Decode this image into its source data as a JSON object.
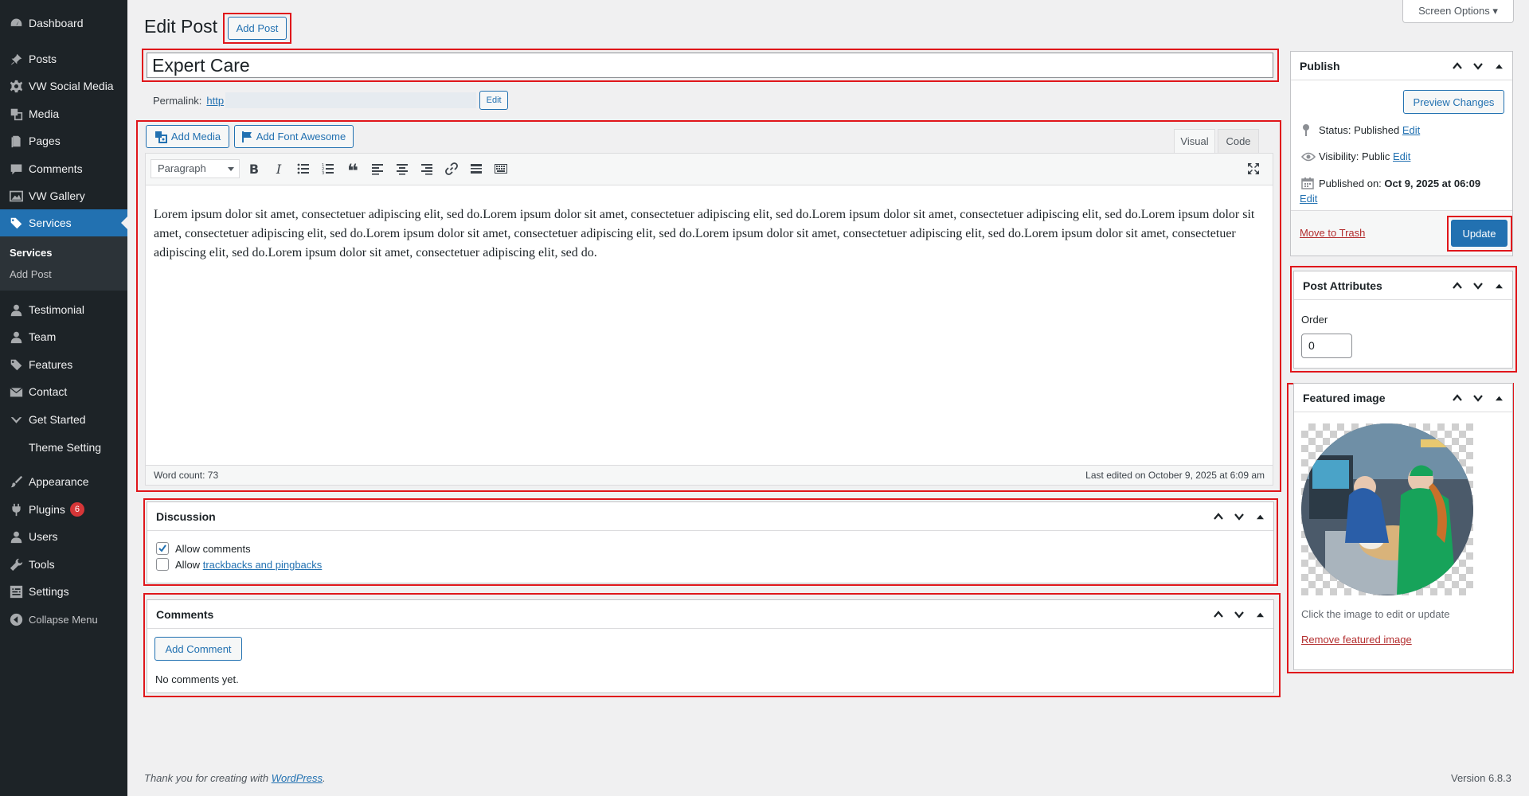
{
  "sidebar": {
    "items": [
      {
        "label": "Dashboard",
        "icon": "dashboard-icon"
      },
      {
        "label": "Posts",
        "icon": "pin-icon"
      },
      {
        "label": "VW Social Media",
        "icon": "gear-icon"
      },
      {
        "label": "Media",
        "icon": "media-icon"
      },
      {
        "label": "Pages",
        "icon": "page-icon"
      },
      {
        "label": "Comments",
        "icon": "comment-icon"
      },
      {
        "label": "VW Gallery",
        "icon": "gallery-icon"
      },
      {
        "label": "Services",
        "icon": "tag-icon"
      },
      {
        "label": "Testimonial",
        "icon": "person-icon"
      },
      {
        "label": "Team",
        "icon": "person-icon"
      },
      {
        "label": "Features",
        "icon": "tag-icon"
      },
      {
        "label": "Contact",
        "icon": "mail-icon"
      },
      {
        "label": "Get Started",
        "icon": "chevron-down-icon"
      },
      {
        "label": "Theme Setting",
        "icon": ""
      },
      {
        "label": "Appearance",
        "icon": "brush-icon"
      },
      {
        "label": "Plugins",
        "icon": "plugin-icon",
        "badge": "6"
      },
      {
        "label": "Users",
        "icon": "users-icon"
      },
      {
        "label": "Tools",
        "icon": "wrench-icon"
      },
      {
        "label": "Settings",
        "icon": "settings-icon"
      },
      {
        "label": "Collapse Menu",
        "icon": "collapse-icon"
      }
    ],
    "submenu": {
      "current": "Services",
      "add": "Add Post"
    },
    "accent": "#2271b1"
  },
  "header": {
    "title": "Edit Post",
    "add_button": "Add Post",
    "screen_options": "Screen Options ▾"
  },
  "post": {
    "title": "Expert Care",
    "permalink_label": "Permalink:",
    "permalink_url": "http",
    "permalink_edit": "Edit"
  },
  "editor": {
    "add_media": "Add Media",
    "add_font_awesome": "Add Font Awesome",
    "tab_visual": "Visual",
    "tab_code": "Code",
    "format_select": "Paragraph",
    "content": "Lorem ipsum dolor sit amet, consectetuer adipiscing elit, sed do.Lorem ipsum dolor sit amet, consectetuer adipiscing elit, sed do.Lorem ipsum dolor sit amet, consectetuer adipiscing elit, sed do.Lorem ipsum dolor sit amet, consectetuer adipiscing elit, sed do.Lorem ipsum dolor sit amet, consectetuer adipiscing elit, sed do.Lorem ipsum dolor sit amet, consectetuer adipiscing elit, sed do.Lorem ipsum dolor sit amet, consectetuer adipiscing elit, sed do.Lorem ipsum dolor sit amet, consectetuer adipiscing elit, sed do.",
    "word_count": "Word count: 73",
    "last_edited": "Last edited on October 9, 2025 at 6:09 am"
  },
  "discussion": {
    "title": "Discussion",
    "allow_comments": "Allow comments",
    "allow_prefix": "Allow",
    "trackbacks_link": "trackbacks and pingbacks"
  },
  "comments": {
    "title": "Comments",
    "add_button": "Add Comment",
    "empty": "No comments yet."
  },
  "publish": {
    "title": "Publish",
    "preview": "Preview Changes",
    "status_label": "Status:",
    "status_value": "Published",
    "status_edit": "Edit",
    "visibility_label": "Visibility:",
    "visibility_value": "Public",
    "visibility_edit": "Edit",
    "published_label": "Published on:",
    "published_value": "Oct 9, 2025 at 06:09",
    "published_edit": "Edit",
    "trash": "Move to Trash",
    "update": "Update"
  },
  "attributes": {
    "title": "Post Attributes",
    "order_label": "Order",
    "order_value": "0"
  },
  "featured": {
    "title": "Featured image",
    "hint": "Click the image to edit or update",
    "remove": "Remove featured image"
  },
  "footer": {
    "thanks_prefix": "Thank you for creating with ",
    "wp_link": "WordPress",
    "thanks_suffix": ".",
    "version": "Version 6.8.3"
  }
}
